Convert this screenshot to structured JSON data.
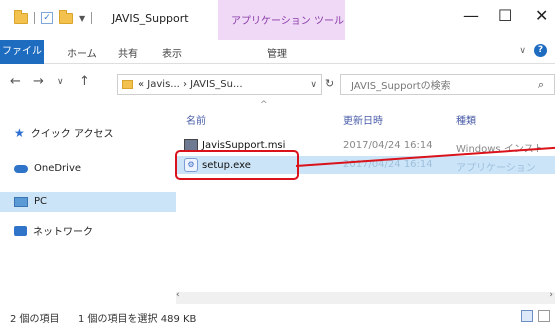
{
  "window": {
    "title": "JAVIS_Support",
    "tool_tab": "アプリケーション ツール"
  },
  "ribbon": {
    "tabs": [
      "ファイル",
      "ホーム",
      "共有",
      "表示",
      "管理"
    ]
  },
  "address": {
    "path": "« Javis... › JAVIS_Su...",
    "search_placeholder": "JAVIS_Supportの検索"
  },
  "navpane": {
    "items": [
      "クイック アクセス",
      "OneDrive",
      "PC",
      "ネットワーク"
    ]
  },
  "columns": {
    "name": "名前",
    "date": "更新日時",
    "type": "種類"
  },
  "files": [
    {
      "name": "JavisSupport.msi",
      "date": "2017/04/24 16:14",
      "type": "Windows インストー"
    },
    {
      "name": "setup.exe",
      "date": "2017/04/24 16:14",
      "type": "アプリケーション"
    }
  ],
  "status": {
    "count": "2 個の項目",
    "selected": "1 個の項目を選択 489 KB"
  },
  "colors": {
    "accent": "#1e6cc0",
    "selection": "#cce4f7",
    "highlight": "#d9121b"
  }
}
